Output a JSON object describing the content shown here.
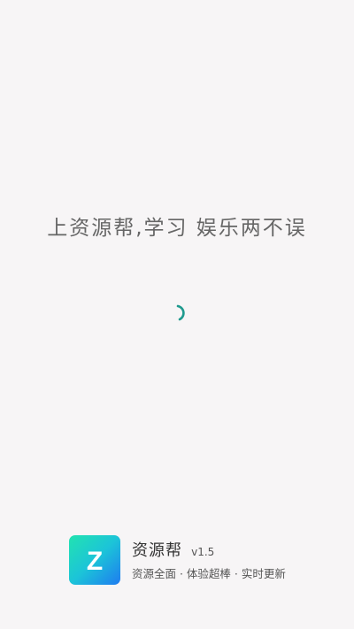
{
  "splash": {
    "slogan": "上资源帮,学习 娱乐两不误"
  },
  "footer": {
    "app_name": "资源帮",
    "version": "v1.5",
    "tagline": "资源全面 · 体验超棒 · 实时更新",
    "logo_letter": "Z"
  },
  "colors": {
    "background": "#f7f5f6",
    "spinner": "#1f9a8e",
    "logo_gradient_start": "#22e3b0",
    "logo_gradient_end": "#1e7bf0"
  }
}
